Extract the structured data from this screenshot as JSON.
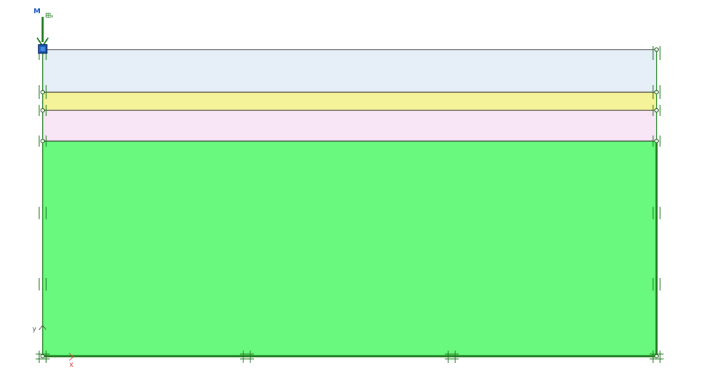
{
  "colors": {
    "background": "#ffffff",
    "layer_1": "#e6eef8",
    "layer_2": "#f5f39a",
    "layer_3": "#f8e6f7",
    "layer_4": "#69f97f",
    "outline": "#1a1a1a",
    "boundary": "#1e7a1e",
    "point_load": "#1f5fbf",
    "axis_y": "#555555",
    "axis_x": "#e04040",
    "node": "#2e6b2e"
  },
  "soil_layers": [
    {
      "id": "layer-1",
      "color_key": "layer_1"
    },
    {
      "id": "layer-2",
      "color_key": "layer_2"
    },
    {
      "id": "layer-3",
      "color_key": "layer_3"
    },
    {
      "id": "layer-4",
      "color_key": "layer_4"
    }
  ],
  "axes": {
    "y_label": "y",
    "x_label": "x"
  },
  "load": {
    "top_glyph": "M",
    "side_glyph": "m"
  }
}
